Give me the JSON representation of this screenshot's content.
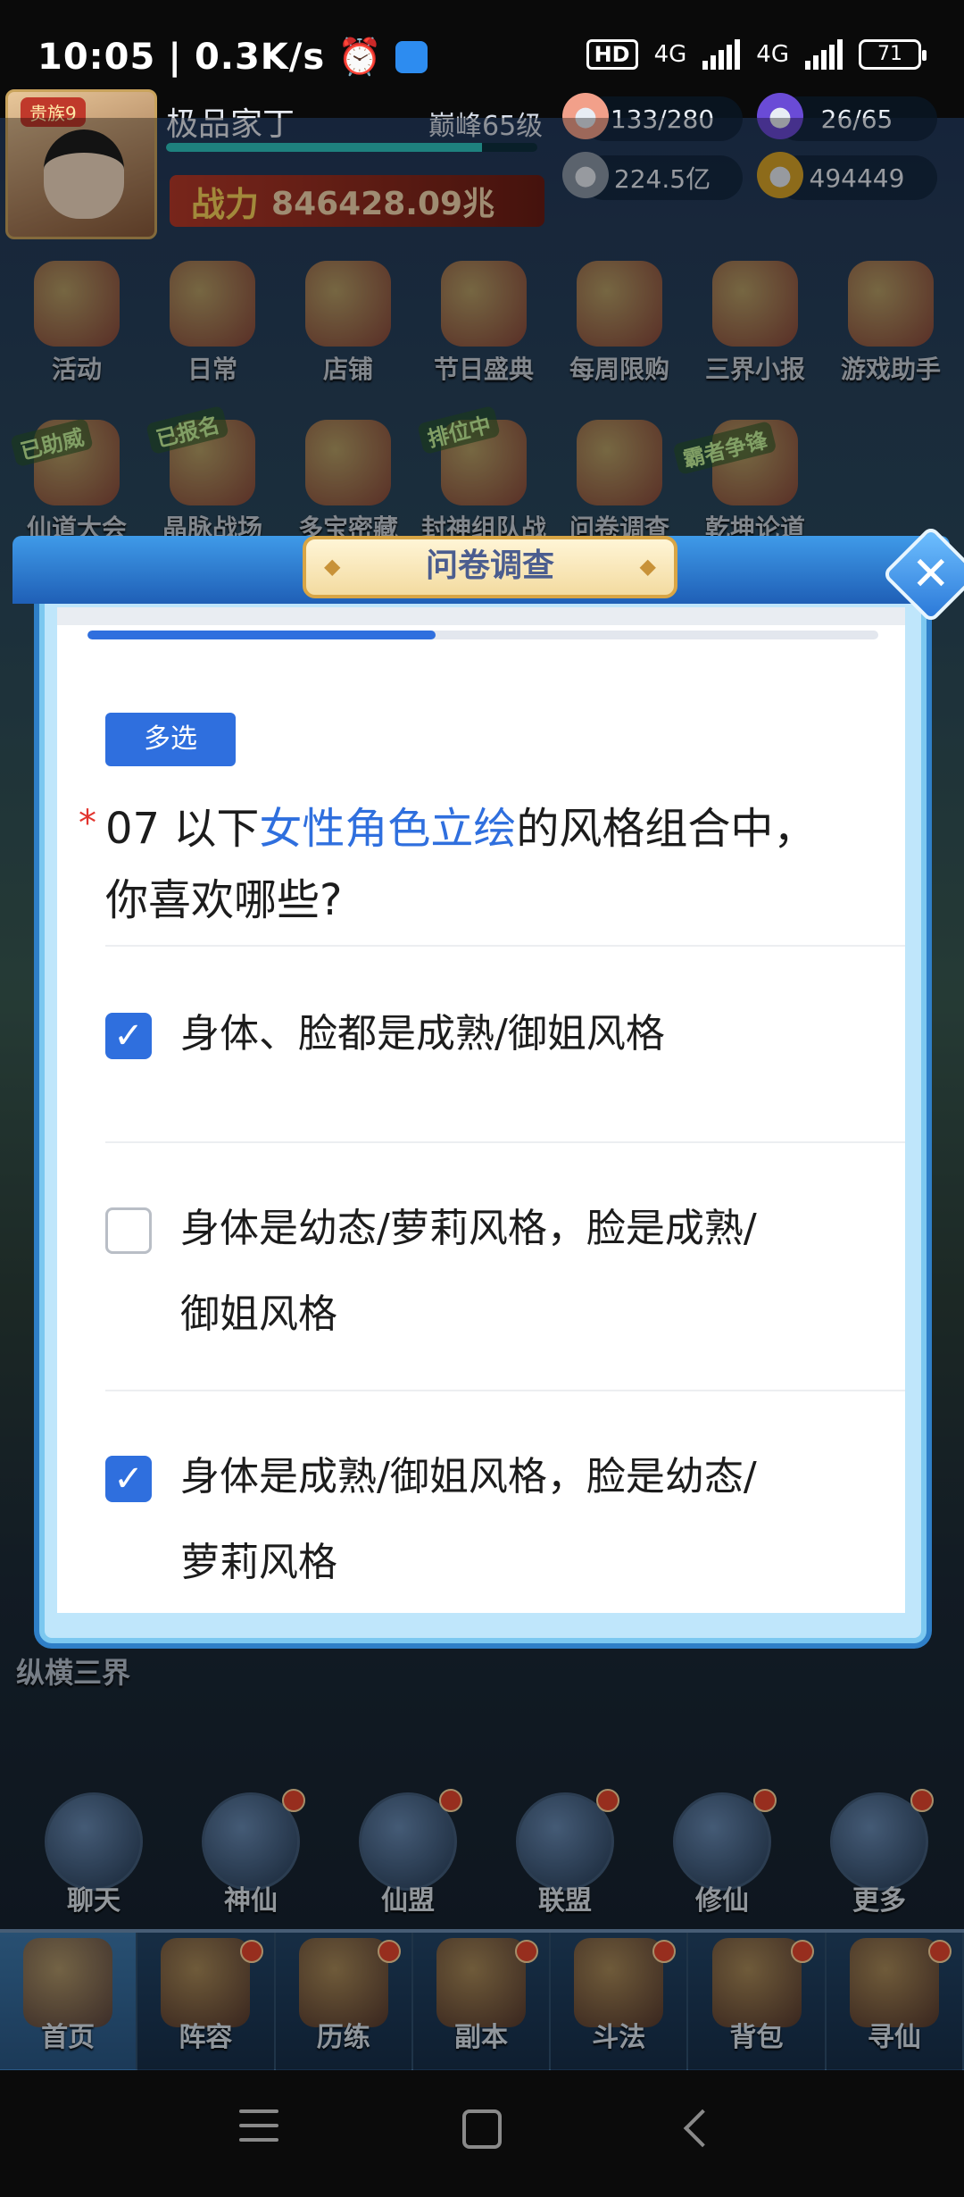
{
  "status_bar": {
    "time": "10:05",
    "speed": "0.3K/s",
    "hd_badge": "HD",
    "net1": "4G",
    "net2": "4G",
    "battery": "71"
  },
  "player": {
    "vip": "贵族9",
    "name": "极品家丁",
    "level": "巅峰65级",
    "xp_fraction": 0.85,
    "power_label": "战力",
    "power_value": "846428.09兆"
  },
  "resources": {
    "stamina": "133/280",
    "spirit": "26/65",
    "silver": "224.5亿",
    "gold": "494449"
  },
  "top_icons": [
    "活动",
    "日常",
    "店铺",
    "节日盛典",
    "每周限购",
    "三界小报",
    "游戏助手"
  ],
  "second_icons": [
    "仙道大会",
    "晶脉战场",
    "多宝密藏",
    "封神组队战",
    "问卷调查",
    "乾坤论道"
  ],
  "tags": {
    "helped": "已助威",
    "signed_up": "已报名",
    "ranking": "排位中",
    "contest": "霸者争锋"
  },
  "scroll_label": "纵横三界",
  "mid_icons": [
    "聊天",
    "神仙",
    "仙盟",
    "联盟",
    "修仙",
    "更多"
  ],
  "nav": {
    "items": [
      "首页",
      "阵容",
      "历练",
      "副本",
      "斗法",
      "背包",
      "寻仙"
    ],
    "active_index": 0
  },
  "survey": {
    "title": "问卷调查",
    "progress_fraction": 0.44,
    "type_badge": "多选",
    "required_mark": "*",
    "question_prefix": "07 以下",
    "question_highlight": "女性角色立绘",
    "question_suffix": "的风格组合中，你喜欢哪些?",
    "options": [
      {
        "text": "身体、脸都是成熟/御姐风格",
        "checked": true
      },
      {
        "text": "身体是幼态/萝莉风格，脸是成熟/御姐风格",
        "checked": false
      },
      {
        "text": "身体是成熟/御姐风格，脸是幼态/萝莉风格",
        "checked": true
      }
    ],
    "close_symbol": "✕"
  },
  "colors": {
    "accent": "#2f6fde",
    "required": "#e2342e"
  }
}
